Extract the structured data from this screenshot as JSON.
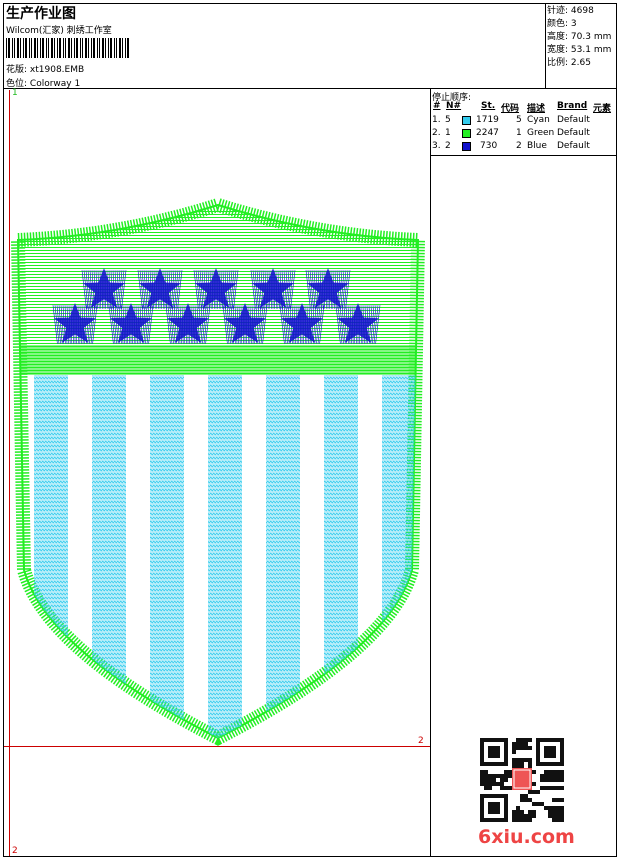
{
  "header": {
    "title": "生产作业图",
    "subtitle": "Wilcom(汇家) 刺绣工作室",
    "design_label": "花版:",
    "design_value": "xt1908.EMB",
    "colorway_label": "色位:",
    "colorway_value": "Colorway 1"
  },
  "stats": [
    {
      "label": "针迹:",
      "value": "4698"
    },
    {
      "label": "颜色:",
      "value": "3"
    },
    {
      "label": "高度:",
      "value": "70.3 mm"
    },
    {
      "label": "宽度:",
      "value": "53.1 mm"
    },
    {
      "label": "比例:",
      "value": "2.65"
    }
  ],
  "stop_sequence": {
    "heading": "停止顺序:",
    "columns": [
      "#",
      "N#",
      "St.",
      "代码",
      "描述",
      "Brand",
      "元素"
    ],
    "rows": [
      {
        "index": "1.",
        "n": "5",
        "color": "#33ccee",
        "stitches": "1719",
        "code": "5",
        "desc": "Cyan",
        "brand": "Default"
      },
      {
        "index": "2.",
        "n": "1",
        "color": "#22ee22",
        "stitches": "2247",
        "code": "1",
        "desc": "Green",
        "brand": "Default"
      },
      {
        "index": "3.",
        "n": "2",
        "color": "#1111cc",
        "stitches": "730",
        "code": "2",
        "desc": "Blue",
        "brand": "Default"
      }
    ]
  },
  "markers": {
    "top_left": "1",
    "right": "2",
    "bottom_left": "2"
  },
  "watermark": {
    "logo_text": "6xiu.com"
  },
  "colors": {
    "green": "#22ee22",
    "cyan": "#33ccee",
    "blue": "#1111cc",
    "guide_red": "#cc0000"
  }
}
